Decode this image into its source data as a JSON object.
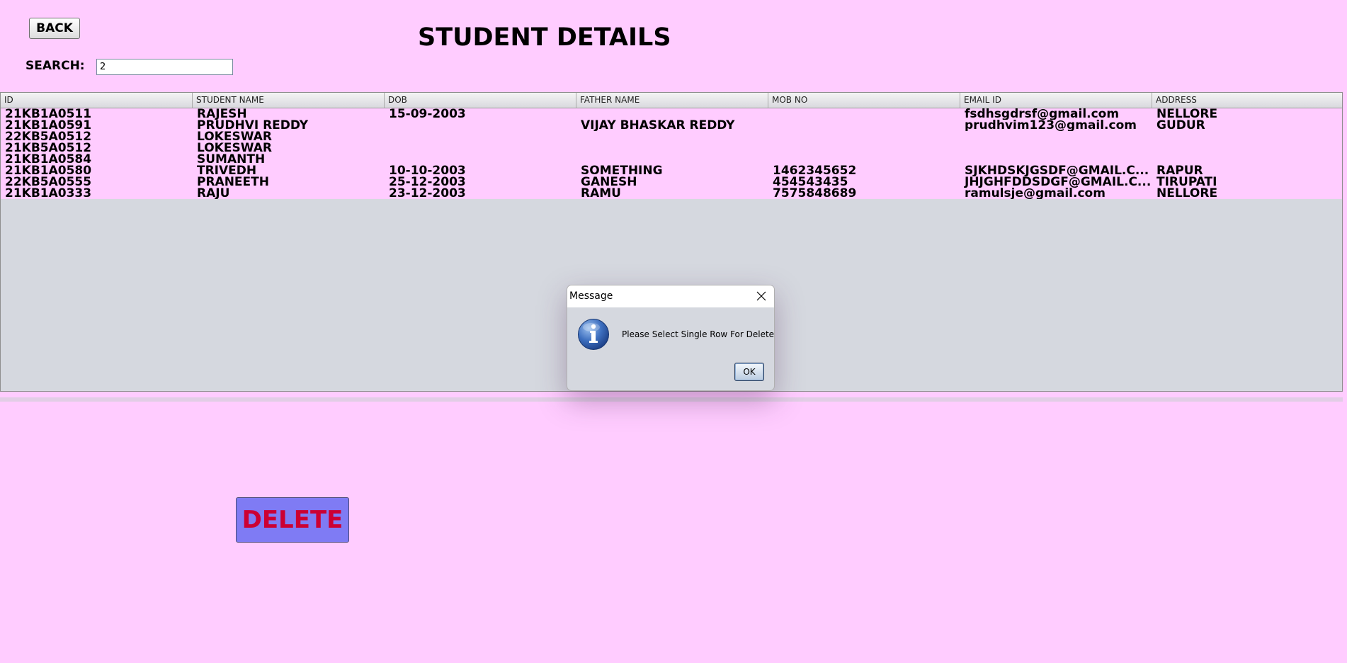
{
  "header": {
    "back_label": "BACK",
    "title": "STUDENT DETAILS",
    "search_label": "SEARCH:",
    "search_value": "2"
  },
  "table": {
    "columns": [
      "ID",
      "STUDENT NAME",
      "DOB",
      "FATHER NAME",
      "MOB NO",
      "EMAIL ID",
      "ADDRESS"
    ],
    "rows": [
      [
        "21KB1A0511",
        "RAJESH",
        "15-09-2003",
        "",
        "",
        "fsdhsgdrsf@gmail.com",
        "NELLORE"
      ],
      [
        "21KB1A0591",
        "PRUDHVI REDDY",
        "",
        "VIJAY BHASKAR REDDY",
        "",
        "prudhvim123@gmail.com",
        "GUDUR"
      ],
      [
        "22KB5A0512",
        "LOKESWAR",
        "",
        "",
        "",
        "",
        ""
      ],
      [
        "21KB5A0512",
        "LOKESWAR",
        "",
        "",
        "",
        "",
        ""
      ],
      [
        "21KB1A0584",
        "SUMANTH",
        "",
        "",
        "",
        "",
        ""
      ],
      [
        "21KB1A0580",
        "TRIVEDH",
        "10-10-2003",
        "SOMETHING",
        "1462345652",
        "SJKHDSKJGSDF@GMAIL.C...",
        "RAPUR"
      ],
      [
        "22KB5A0555",
        "PRANEETH",
        "25-12-2003",
        "GANESH",
        "454543435",
        "JHJGHFDDSDGF@GMAIL.C...",
        "TIRUPATI"
      ],
      [
        "21KB1A0333",
        "RAJU",
        "23-12-2003",
        "RAMU",
        "7575848689",
        "ramulsje@gmail.com",
        "NELLORE"
      ]
    ]
  },
  "actions": {
    "delete_label": "DELETE"
  },
  "dialog": {
    "title": "Message",
    "message": "Please Select Single Row For Delete",
    "ok_label": "OK",
    "icon": "info-icon",
    "close_icon": "close-icon"
  },
  "colors": {
    "background": "#ffccff",
    "table_empty_area": "#d5d8df",
    "delete_button_bg": "#7f7bf4",
    "delete_button_text": "#cc0033",
    "info_icon_blue": "#2f5fb0"
  }
}
